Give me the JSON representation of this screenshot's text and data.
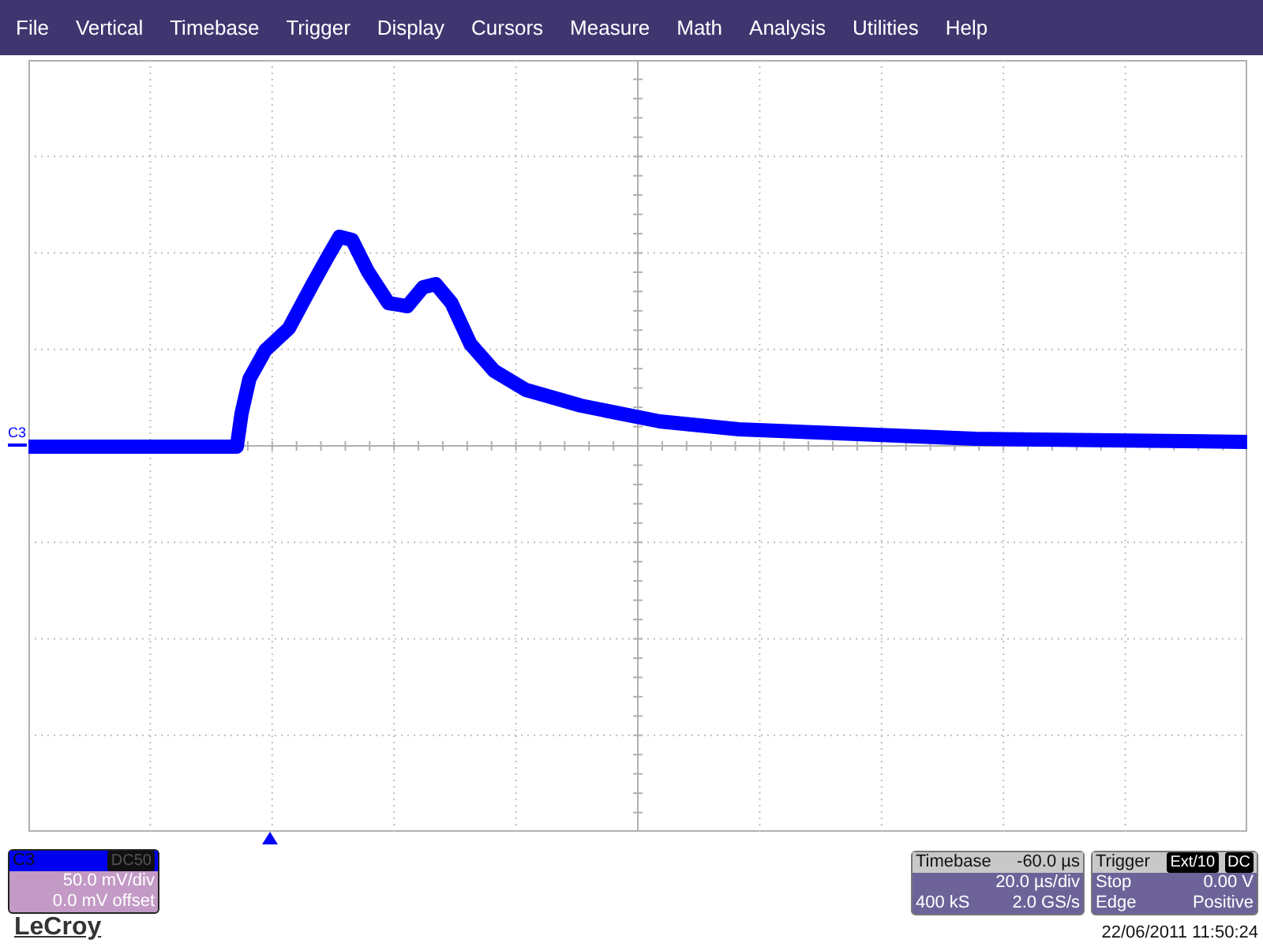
{
  "menu": [
    "File",
    "Vertical",
    "Timebase",
    "Trigger",
    "Display",
    "Cursors",
    "Measure",
    "Math",
    "Analysis",
    "Utilities",
    "Help"
  ],
  "trace_label": "C3",
  "channel": {
    "label": "C3",
    "coupling": "DC50",
    "scale": "50.0 mV/div",
    "offset": "0.0 mV offset"
  },
  "logo": "LeCroy",
  "timebase": {
    "title": "Timebase",
    "delay": "-60.0 µs",
    "scale": "20.0 µs/div",
    "samples": "400 kS",
    "rate": "2.0 GS/s"
  },
  "trigger": {
    "title": "Trigger",
    "source": "Ext/10",
    "coupling": "DC",
    "mode": "Stop",
    "threshold": "0.00 V",
    "type": "Edge",
    "slope": "Positive"
  },
  "timestamp": "22/06/2011 11:50:24"
}
